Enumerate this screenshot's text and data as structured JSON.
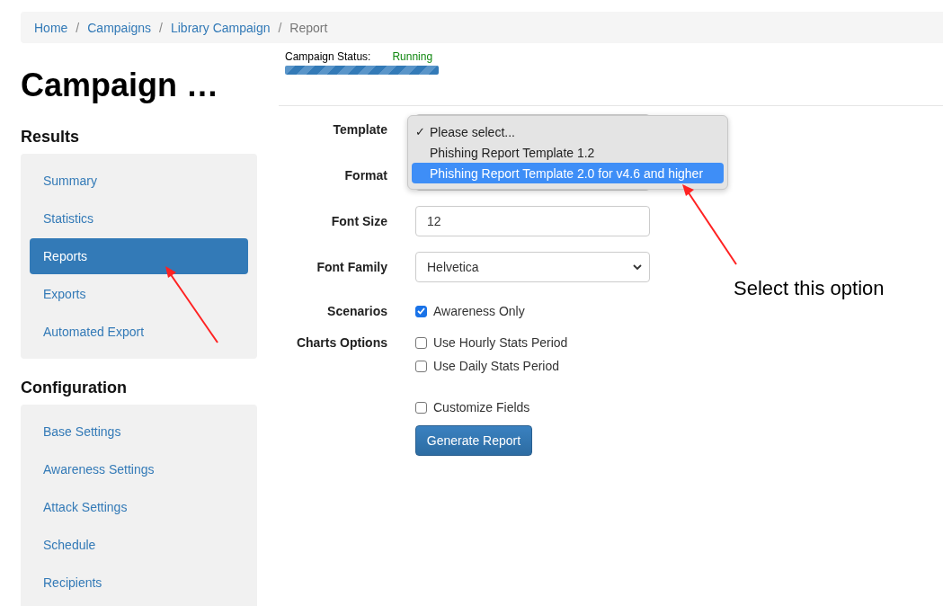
{
  "breadcrumb": [
    {
      "label": "Home",
      "current": false
    },
    {
      "label": "Campaigns",
      "current": false
    },
    {
      "label": "Library Campaign",
      "current": false
    },
    {
      "label": "Report",
      "current": true
    }
  ],
  "breadcrumb_separator": "/",
  "title": "Campaign …",
  "status": {
    "label": "Campaign Status:",
    "value": "Running",
    "level": 1
  },
  "sidebar": [
    {
      "heading": "Results",
      "items": [
        {
          "label": "Summary",
          "selected": false
        },
        {
          "label": "Statistics",
          "selected": false
        },
        {
          "label": "Reports",
          "selected": true
        },
        {
          "label": "Exports",
          "selected": false
        },
        {
          "label": "Automated Export",
          "selected": false
        }
      ]
    },
    {
      "heading": "Configuration",
      "items": [
        {
          "label": "Base Settings",
          "selected": false
        },
        {
          "label": "Awareness Settings",
          "selected": false
        },
        {
          "label": "Attack Settings",
          "selected": false
        },
        {
          "label": "Schedule",
          "selected": false
        },
        {
          "label": "Recipients",
          "selected": false
        }
      ]
    }
  ],
  "form": {
    "rows": [
      {
        "kind": "select",
        "label": "Template"
      },
      {
        "kind": "select",
        "label": "Format"
      },
      {
        "kind": "text",
        "label": "Font Size",
        "value": "12"
      },
      {
        "kind": "select",
        "label": "Font Family",
        "value": "Helvetica"
      },
      {
        "kind": "checks",
        "label": "Scenarios",
        "options": [
          {
            "label": "Awareness Only",
            "checked": true
          }
        ]
      },
      {
        "kind": "checks",
        "label": "Charts Options",
        "options": [
          {
            "label": "Use Hourly Stats Period",
            "checked": false
          },
          {
            "label": "Use Daily Stats Period",
            "checked": false
          }
        ]
      },
      {
        "kind": "checks",
        "options": [
          {
            "label": "Customize Fields",
            "checked": false
          }
        ]
      }
    ],
    "button": "Generate Report"
  },
  "dropdown_menu": {
    "check_glyph": "✓",
    "options": [
      {
        "label": "Please select...",
        "checked": true,
        "highlighted": false
      },
      {
        "label": "Phishing Report Template 1.2",
        "checked": false,
        "highlighted": false
      },
      {
        "label": "Phishing Report Template 2.0 for v4.6 and higher",
        "checked": false,
        "highlighted": true
      }
    ]
  },
  "annotation": {
    "text": "Select this option"
  }
}
